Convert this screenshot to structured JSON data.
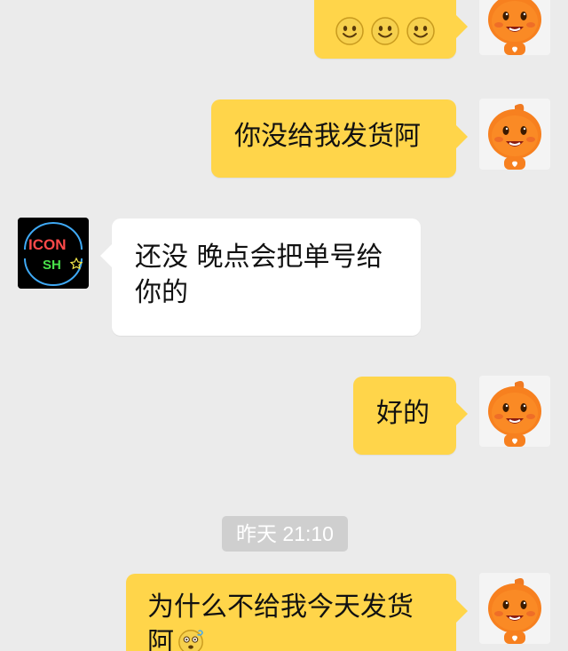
{
  "messages": [
    {
      "side": "me",
      "type": "emoji",
      "emoji_count": 3,
      "emoji_icon": "smile-emoji-icon"
    },
    {
      "side": "me",
      "type": "text",
      "text": "你没给我发货阿"
    },
    {
      "side": "other",
      "type": "text",
      "line1": "还没 晚点会把单号给",
      "line2": "你的"
    },
    {
      "side": "me",
      "type": "text",
      "text": "好的"
    },
    {
      "side": "me",
      "type": "text",
      "line1": "为什么不给我今天发货",
      "line2": "阿",
      "trailing_emoji": "dizzy-emoji-icon"
    }
  ],
  "timestamp": "昨天 21:10",
  "avatars": {
    "me": "orange-mascot-avatar",
    "other_logo": {
      "line1": "ICON",
      "line2": "SH"
    }
  },
  "colors": {
    "background": "#ebebeb",
    "my_bubble": "#ffd54a",
    "their_bubble": "#ffffff",
    "timestamp_bg": "#cfcfcf"
  }
}
